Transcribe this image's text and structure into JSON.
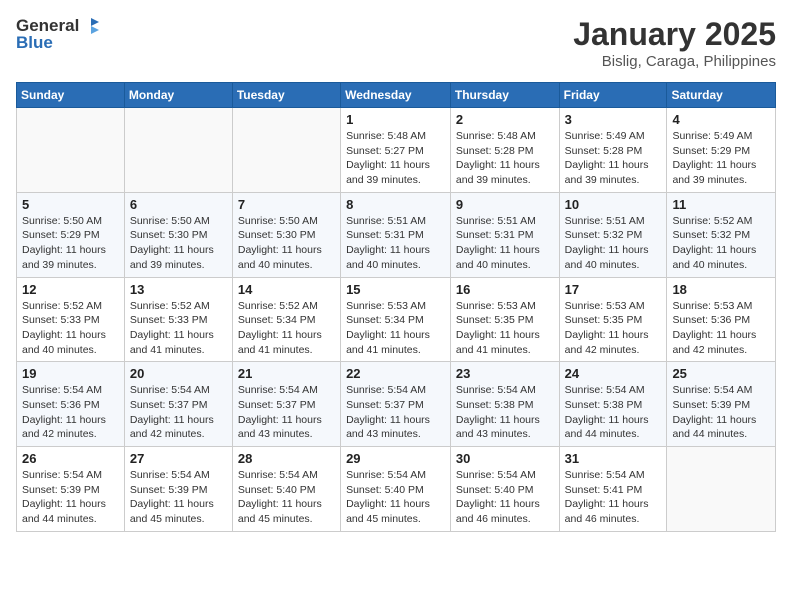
{
  "logo": {
    "text_general": "General",
    "text_blue": "Blue"
  },
  "header": {
    "month": "January 2025",
    "location": "Bislig, Caraga, Philippines"
  },
  "weekdays": [
    "Sunday",
    "Monday",
    "Tuesday",
    "Wednesday",
    "Thursday",
    "Friday",
    "Saturday"
  ],
  "weeks": [
    [
      {
        "day": "",
        "sunrise": "",
        "sunset": "",
        "daylight": ""
      },
      {
        "day": "",
        "sunrise": "",
        "sunset": "",
        "daylight": ""
      },
      {
        "day": "",
        "sunrise": "",
        "sunset": "",
        "daylight": ""
      },
      {
        "day": "1",
        "sunrise": "Sunrise: 5:48 AM",
        "sunset": "Sunset: 5:27 PM",
        "daylight": "Daylight: 11 hours and 39 minutes."
      },
      {
        "day": "2",
        "sunrise": "Sunrise: 5:48 AM",
        "sunset": "Sunset: 5:28 PM",
        "daylight": "Daylight: 11 hours and 39 minutes."
      },
      {
        "day": "3",
        "sunrise": "Sunrise: 5:49 AM",
        "sunset": "Sunset: 5:28 PM",
        "daylight": "Daylight: 11 hours and 39 minutes."
      },
      {
        "day": "4",
        "sunrise": "Sunrise: 5:49 AM",
        "sunset": "Sunset: 5:29 PM",
        "daylight": "Daylight: 11 hours and 39 minutes."
      }
    ],
    [
      {
        "day": "5",
        "sunrise": "Sunrise: 5:50 AM",
        "sunset": "Sunset: 5:29 PM",
        "daylight": "Daylight: 11 hours and 39 minutes."
      },
      {
        "day": "6",
        "sunrise": "Sunrise: 5:50 AM",
        "sunset": "Sunset: 5:30 PM",
        "daylight": "Daylight: 11 hours and 39 minutes."
      },
      {
        "day": "7",
        "sunrise": "Sunrise: 5:50 AM",
        "sunset": "Sunset: 5:30 PM",
        "daylight": "Daylight: 11 hours and 40 minutes."
      },
      {
        "day": "8",
        "sunrise": "Sunrise: 5:51 AM",
        "sunset": "Sunset: 5:31 PM",
        "daylight": "Daylight: 11 hours and 40 minutes."
      },
      {
        "day": "9",
        "sunrise": "Sunrise: 5:51 AM",
        "sunset": "Sunset: 5:31 PM",
        "daylight": "Daylight: 11 hours and 40 minutes."
      },
      {
        "day": "10",
        "sunrise": "Sunrise: 5:51 AM",
        "sunset": "Sunset: 5:32 PM",
        "daylight": "Daylight: 11 hours and 40 minutes."
      },
      {
        "day": "11",
        "sunrise": "Sunrise: 5:52 AM",
        "sunset": "Sunset: 5:32 PM",
        "daylight": "Daylight: 11 hours and 40 minutes."
      }
    ],
    [
      {
        "day": "12",
        "sunrise": "Sunrise: 5:52 AM",
        "sunset": "Sunset: 5:33 PM",
        "daylight": "Daylight: 11 hours and 40 minutes."
      },
      {
        "day": "13",
        "sunrise": "Sunrise: 5:52 AM",
        "sunset": "Sunset: 5:33 PM",
        "daylight": "Daylight: 11 hours and 41 minutes."
      },
      {
        "day": "14",
        "sunrise": "Sunrise: 5:52 AM",
        "sunset": "Sunset: 5:34 PM",
        "daylight": "Daylight: 11 hours and 41 minutes."
      },
      {
        "day": "15",
        "sunrise": "Sunrise: 5:53 AM",
        "sunset": "Sunset: 5:34 PM",
        "daylight": "Daylight: 11 hours and 41 minutes."
      },
      {
        "day": "16",
        "sunrise": "Sunrise: 5:53 AM",
        "sunset": "Sunset: 5:35 PM",
        "daylight": "Daylight: 11 hours and 41 minutes."
      },
      {
        "day": "17",
        "sunrise": "Sunrise: 5:53 AM",
        "sunset": "Sunset: 5:35 PM",
        "daylight": "Daylight: 11 hours and 42 minutes."
      },
      {
        "day": "18",
        "sunrise": "Sunrise: 5:53 AM",
        "sunset": "Sunset: 5:36 PM",
        "daylight": "Daylight: 11 hours and 42 minutes."
      }
    ],
    [
      {
        "day": "19",
        "sunrise": "Sunrise: 5:54 AM",
        "sunset": "Sunset: 5:36 PM",
        "daylight": "Daylight: 11 hours and 42 minutes."
      },
      {
        "day": "20",
        "sunrise": "Sunrise: 5:54 AM",
        "sunset": "Sunset: 5:37 PM",
        "daylight": "Daylight: 11 hours and 42 minutes."
      },
      {
        "day": "21",
        "sunrise": "Sunrise: 5:54 AM",
        "sunset": "Sunset: 5:37 PM",
        "daylight": "Daylight: 11 hours and 43 minutes."
      },
      {
        "day": "22",
        "sunrise": "Sunrise: 5:54 AM",
        "sunset": "Sunset: 5:37 PM",
        "daylight": "Daylight: 11 hours and 43 minutes."
      },
      {
        "day": "23",
        "sunrise": "Sunrise: 5:54 AM",
        "sunset": "Sunset: 5:38 PM",
        "daylight": "Daylight: 11 hours and 43 minutes."
      },
      {
        "day": "24",
        "sunrise": "Sunrise: 5:54 AM",
        "sunset": "Sunset: 5:38 PM",
        "daylight": "Daylight: 11 hours and 44 minutes."
      },
      {
        "day": "25",
        "sunrise": "Sunrise: 5:54 AM",
        "sunset": "Sunset: 5:39 PM",
        "daylight": "Daylight: 11 hours and 44 minutes."
      }
    ],
    [
      {
        "day": "26",
        "sunrise": "Sunrise: 5:54 AM",
        "sunset": "Sunset: 5:39 PM",
        "daylight": "Daylight: 11 hours and 44 minutes."
      },
      {
        "day": "27",
        "sunrise": "Sunrise: 5:54 AM",
        "sunset": "Sunset: 5:39 PM",
        "daylight": "Daylight: 11 hours and 45 minutes."
      },
      {
        "day": "28",
        "sunrise": "Sunrise: 5:54 AM",
        "sunset": "Sunset: 5:40 PM",
        "daylight": "Daylight: 11 hours and 45 minutes."
      },
      {
        "day": "29",
        "sunrise": "Sunrise: 5:54 AM",
        "sunset": "Sunset: 5:40 PM",
        "daylight": "Daylight: 11 hours and 45 minutes."
      },
      {
        "day": "30",
        "sunrise": "Sunrise: 5:54 AM",
        "sunset": "Sunset: 5:40 PM",
        "daylight": "Daylight: 11 hours and 46 minutes."
      },
      {
        "day": "31",
        "sunrise": "Sunrise: 5:54 AM",
        "sunset": "Sunset: 5:41 PM",
        "daylight": "Daylight: 11 hours and 46 minutes."
      },
      {
        "day": "",
        "sunrise": "",
        "sunset": "",
        "daylight": ""
      }
    ]
  ]
}
